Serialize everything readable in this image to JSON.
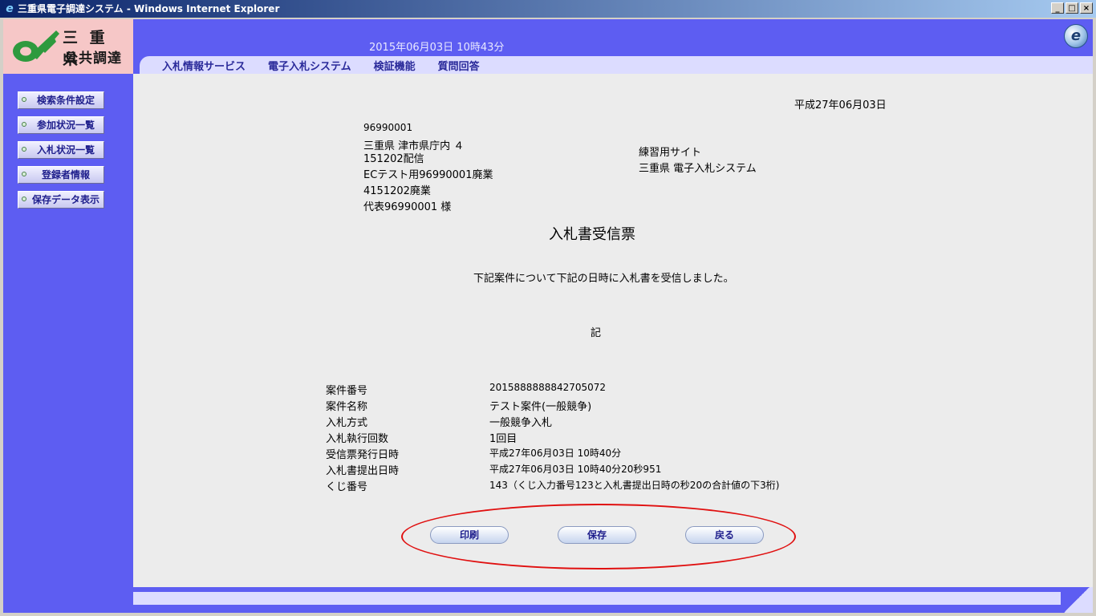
{
  "window": {
    "title": "三重県電子調達システム - Windows Internet Explorer",
    "buttons": [
      "_",
      "□",
      "×"
    ]
  },
  "logo": {
    "line1": "三 重 県",
    "line2": "公共調達"
  },
  "header": {
    "datetime": "2015年06月03日 10時43分"
  },
  "nav": {
    "items": [
      "入札情報サービス",
      "電子入札システム",
      "検証機能",
      "質問回答"
    ]
  },
  "sidebar": {
    "items": [
      "検索条件設定",
      "参加状況一覧",
      "入札状況一覧",
      "登録者情報",
      "保存データ表示"
    ]
  },
  "document": {
    "date": "平成27年06月03日",
    "recipient": {
      "code": "96990001",
      "address1": "三重県 津市県庁内 ４",
      "address2": "151202配信",
      "company1": "ECテスト用96990001廃業",
      "company2": "4151202廃業",
      "rep": "代表96990001 様"
    },
    "sender": {
      "line1": "練習用サイト",
      "line2": "三重県 電子入札システム"
    },
    "title": "入札書受信票",
    "message": "下記案件について下記の日時に入札書を受信しました。",
    "ki": "記",
    "fields": [
      {
        "label": "案件番号",
        "value": "2015888888842705072"
      },
      {
        "label": "案件名称",
        "value": "テスト案件(一般競争)"
      },
      {
        "label": "入札方式",
        "value": "一般競争入札"
      },
      {
        "label": "入札執行回数",
        "value": "1回目"
      },
      {
        "label": "受信票発行日時",
        "value": "平成27年06月03日 10時40分"
      },
      {
        "label": "入札書提出日時",
        "value": "平成27年06月03日 10時40分20秒951"
      },
      {
        "label": "くじ番号",
        "value": "143（くじ入力番号123と入札書提出日時の秒20の合計値の下3桁)"
      }
    ]
  },
  "actions": {
    "print": "印刷",
    "save": "保存",
    "back": "戻る"
  }
}
